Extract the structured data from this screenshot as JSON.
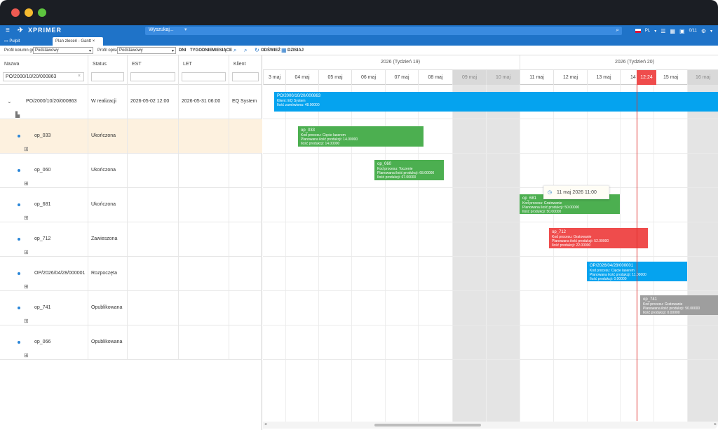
{
  "app": {
    "brand": "XPRIMER",
    "search_label": "Wyszukaj...",
    "lang": "PL",
    "user": "0/11"
  },
  "tabs": [
    {
      "label": "Pulpit"
    },
    {
      "label": "Plan zleceń - Gantt"
    }
  ],
  "toolbar": {
    "profile_label": "Profil kolumn grid",
    "profile_value": "Podstawowy",
    "profile2_label": "Profil opisu",
    "profile2_value": "Podstawowy",
    "views": [
      "DNI",
      "TYGODNIE",
      "MIESIĄCE"
    ],
    "refresh": "ODŚWIEŻ",
    "today": "DZISIAJ"
  },
  "columns": [
    {
      "title": "Nazwa",
      "filter": "PO/2000/10/20/000863"
    },
    {
      "title": "Status",
      "filter": ""
    },
    {
      "title": "EST",
      "filter": ""
    },
    {
      "title": "LET",
      "filter": ""
    },
    {
      "title": "Klient",
      "filter": ""
    }
  ],
  "rows": [
    {
      "name": "PO/2000/10/20/000863",
      "status": "W realizacji",
      "est": "2026-05-02 12:00",
      "let": "2026-05-31 06:00",
      "client": "EQ System"
    },
    {
      "name": "op_033",
      "status": "Ukończona",
      "est": "",
      "let": "",
      "client": ""
    },
    {
      "name": "op_060",
      "status": "Ukończona",
      "est": "",
      "let": "",
      "client": ""
    },
    {
      "name": "op_681",
      "status": "Ukończona",
      "est": "",
      "let": "",
      "client": ""
    },
    {
      "name": "op_712",
      "status": "Zawieszona",
      "est": "",
      "let": "",
      "client": ""
    },
    {
      "name": "OP/2026/04/28/000001",
      "status": "Rozpoczęta",
      "est": "",
      "let": "",
      "client": ""
    },
    {
      "name": "op_741",
      "status": "Opublikowana",
      "est": "",
      "let": "",
      "client": ""
    },
    {
      "name": "op_066",
      "status": "Opublikowana",
      "est": "",
      "let": "",
      "client": ""
    }
  ],
  "gantt": {
    "weeks": [
      "2026 (Tydzień 19)",
      "2026 (Tydzień 20)"
    ],
    "days": [
      "3 maj",
      "04 maj",
      "05 maj",
      "06 maj",
      "07 maj",
      "08 maj",
      "09 maj",
      "10 maj",
      "11 maj",
      "12 maj",
      "13 maj",
      "14 maj",
      "15 maj",
      "16 maj"
    ],
    "now_label": "12:24",
    "tooltip": "11 maj 2026 11:00",
    "bars": [
      {
        "title": "PO/2000/10/20/000863",
        "l1": "Klient: EQ System",
        "l2": "Ilość zamówiona: 48.00000",
        "l3": ""
      },
      {
        "title": "op_033",
        "l1": "Kod procesu: Cięcie laserem",
        "l2": "Planowana ilość produkcji: 14.00000",
        "l3": "Ilość produkcji: 14.00000"
      },
      {
        "title": "op_060",
        "l1": "Kod procesu: Toczenie",
        "l2": "Planowana ilość produkcji: 68.00000",
        "l3": "Ilość produkcji: 67.00000"
      },
      {
        "title": "op_681",
        "l1": "Kod procesu: Gratowanie",
        "l2": "Planowana ilość produkcji: 50.00000",
        "l3": "Ilość produkcji: 50.00000"
      },
      {
        "title": "op_712",
        "l1": "Kod procesu: Gratowanie",
        "l2": "Planowana ilość produkcji: 52.00000",
        "l3": "Ilość produkcji: 22.00000"
      },
      {
        "title": "OP/2026/04/28/000001",
        "l1": "Kod procesu: Cięcie laserem",
        "l2": "Planowana ilość produkcji: 11.00000",
        "l3": "Ilość produkcji: 0.00000"
      },
      {
        "title": "op_741",
        "l1": "Kod procesu: Gratowanie",
        "l2": "Planowana ilość produkcji: 50.00000",
        "l3": "Ilość produkcji: 0.00000"
      }
    ]
  }
}
